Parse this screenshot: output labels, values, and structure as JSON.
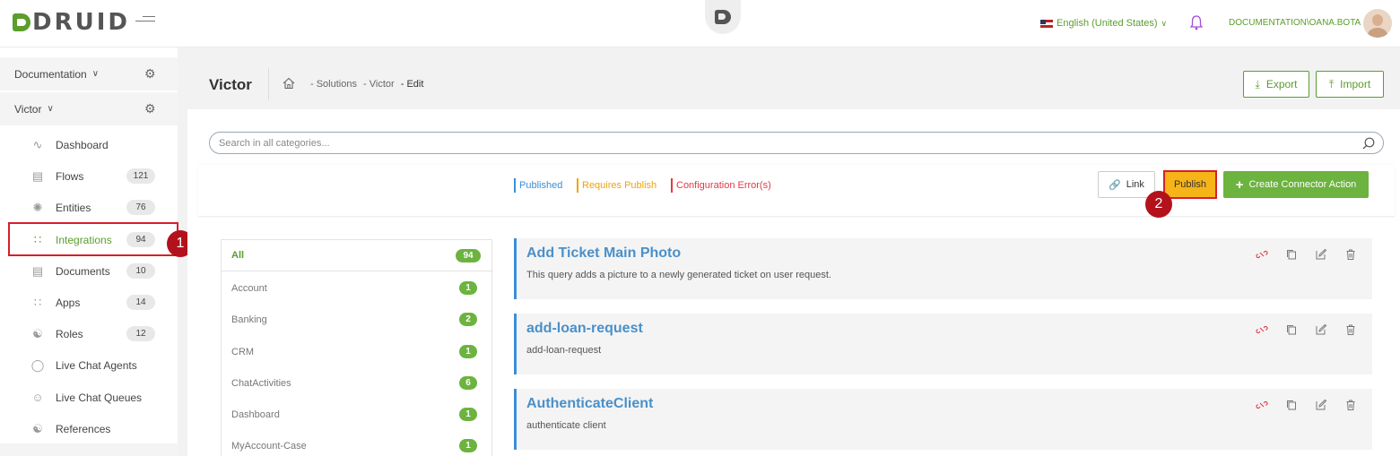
{
  "header": {
    "logo_text": "DRUID",
    "language": "English (United States)",
    "username": "DOCUMENTATION\\OANA.BOTA"
  },
  "sidebar": {
    "groups": [
      {
        "label": "Documentation"
      },
      {
        "label": "Victor"
      }
    ],
    "items": [
      {
        "label": "Dashboard",
        "icon": "chart-icon",
        "count": ""
      },
      {
        "label": "Flows",
        "icon": "chat-icon",
        "count": "121"
      },
      {
        "label": "Entities",
        "icon": "nodes-icon",
        "count": "76"
      },
      {
        "label": "Integrations",
        "icon": "grid-icon",
        "count": "94"
      },
      {
        "label": "Documents",
        "icon": "document-icon",
        "count": "10"
      },
      {
        "label": "Apps",
        "icon": "grid-icon",
        "count": "14"
      },
      {
        "label": "Roles",
        "icon": "hierarchy-icon",
        "count": "12"
      },
      {
        "label": "Live Chat Agents",
        "icon": "user-circle-icon",
        "count": ""
      },
      {
        "label": "Live Chat Queues",
        "icon": "users-icon",
        "count": ""
      },
      {
        "label": "References",
        "icon": "hierarchy-icon",
        "count": ""
      }
    ]
  },
  "annotations": {
    "one": "1",
    "two": "2"
  },
  "page": {
    "title": "Victor",
    "breadcrumb": [
      "- Solutions",
      "- Victor",
      "- Edit"
    ],
    "export_label": "Export",
    "import_label": "Import"
  },
  "search": {
    "placeholder": "Search in all categories..."
  },
  "legend": {
    "published": "Published",
    "requires_publish": "Requires Publish",
    "config_error": "Configuration Error(s)"
  },
  "toolbar": {
    "link_label": "Link",
    "publish_label": "Publish",
    "create_label": "Create Connector Action"
  },
  "categories": [
    {
      "label": "All",
      "count": "94"
    },
    {
      "label": "Account",
      "count": "1"
    },
    {
      "label": "Banking",
      "count": "2"
    },
    {
      "label": "CRM",
      "count": "1"
    },
    {
      "label": "ChatActivities",
      "count": "6"
    },
    {
      "label": "Dashboard",
      "count": "1"
    },
    {
      "label": "MyAccount-Case",
      "count": "1"
    }
  ],
  "integrations": [
    {
      "title": "Add Ticket Main Photo",
      "description": "This query adds a picture to a newly generated ticket on user request."
    },
    {
      "title": "add-loan-request",
      "description": "add-loan-request"
    },
    {
      "title": "AuthenticateClient",
      "description": "authenticate client"
    }
  ],
  "colors": {
    "accent_green": "#5a9e2c",
    "publish_yellow": "#f7b418",
    "published_blue": "#3b8fd6",
    "error_red": "#e03a46",
    "highlight_red": "#d81e2c"
  }
}
